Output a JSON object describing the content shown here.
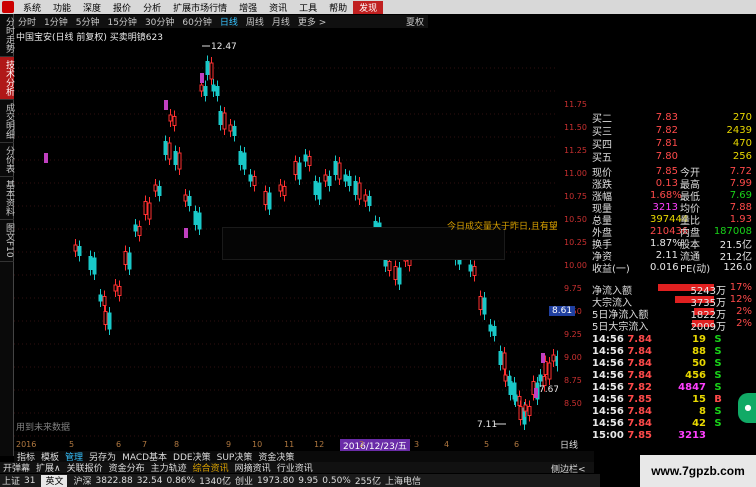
{
  "menubar": {
    "items": [
      "系统",
      "功能",
      "深度",
      "报价",
      "分析",
      "扩展市场行情",
      "增强",
      "资讯",
      "工具",
      "帮助",
      "发现"
    ],
    "active_index": 10
  },
  "periods": {
    "items": [
      "分时",
      "1分钟",
      "5分钟",
      "15分钟",
      "30分钟",
      "60分钟",
      "日线",
      "周线",
      "月线",
      "更多 >"
    ],
    "active_index": 6,
    "right_label": "夏权"
  },
  "side_tabs": {
    "items": [
      "分时走势",
      "技术分析",
      "成交明细",
      "分价表",
      "基本资料",
      "图文F10"
    ],
    "active_index": 1
  },
  "chart": {
    "title": "中国宝安(日线 前复权) 买卖明镜623",
    "high_label": "12.47",
    "low_label": "7.11",
    "marker_right": "7.67",
    "notice": "今日成交量大于昨日,且有望",
    "no_data_text": "用到未来数据"
  },
  "price_axis": {
    "ticks": [
      "11.75",
      "11.50",
      "11.25",
      "11.00",
      "10.75",
      "10.50",
      "10.25",
      "10.00",
      "9.75",
      "9.50",
      "9.25",
      "9.00",
      "8.75",
      "8.50",
      "8.25",
      "8.00",
      "7.75",
      "7.50",
      "7.25"
    ],
    "cursor": "8.61"
  },
  "datebar": {
    "labels": [
      "2016",
      "5",
      "6",
      "7",
      "8",
      "9",
      "10",
      "11",
      "12",
      "2",
      "3",
      "4",
      "5",
      "6"
    ],
    "current_date": "2016/12/23/五",
    "period_label": "日线"
  },
  "indicator_bar": {
    "items": [
      "指标",
      "模板",
      "管理",
      "另存为",
      "MACD基本",
      "DDE决策",
      "SUP决策",
      "资金决策"
    ],
    "active_index": 2
  },
  "bottom_tabs": {
    "items": [
      "开弹幕",
      "扩展∧",
      "关联报价",
      "资金分布",
      "主力轨迹",
      "综合资讯",
      "网摘资讯",
      "行业资讯"
    ],
    "highlight_index": 5,
    "right_label": "侧边栏<"
  },
  "statusbar": {
    "ime_label": "英文",
    "index_name": "上证",
    "index_value": "31",
    "sz_name": "沪深",
    "sz_value": "3822.88",
    "sz_change": "32.54",
    "sz_pct": "0.86%",
    "sz_amount": "1340亿",
    "cy_name": "创业",
    "cy_value": "1973.80",
    "cy_change": "9.95",
    "cy_pct": "0.50%",
    "cy_amount": "255亿",
    "right_text": "上海电信"
  },
  "quote": {
    "asks": [
      {
        "label": "买二",
        "price": "7.83",
        "vol": "270"
      },
      {
        "label": "买三",
        "price": "7.82",
        "vol": "2439"
      },
      {
        "label": "买四",
        "price": "7.81",
        "vol": "470"
      },
      {
        "label": "买五",
        "price": "7.80",
        "vol": "256"
      }
    ],
    "stats": [
      {
        "l1": "现价",
        "v1": "7.85",
        "l2": "今开",
        "v2": "7.72"
      },
      {
        "l1": "涨跌",
        "v1": "0.13",
        "l2": "最高",
        "v2": "7.99"
      },
      {
        "l1": "涨幅",
        "v1": "1.68%",
        "l2": "最低",
        "v2": "7.69"
      },
      {
        "l1": "现量",
        "v1": "3213",
        "l2": "均价",
        "v2": "7.88"
      },
      {
        "l1": "总量",
        "v1": "397444",
        "l2": "量比",
        "v2": "1.93"
      },
      {
        "l1": "外盘",
        "v1": "210436",
        "l2": "内盘",
        "v2": "187008"
      },
      {
        "l1": "换手",
        "v1": "1.87%",
        "l2": "股本",
        "v2": "21.5亿"
      },
      {
        "l1": "净资",
        "v1": "2.11",
        "l2": "流通",
        "v2": "21.2亿"
      },
      {
        "l1": "收益(一)",
        "v1": "0.016",
        "l2": "PE(动)",
        "v2": "126.0"
      }
    ],
    "flows": [
      {
        "label": "净流入额",
        "value": "5243万",
        "pct": "17%",
        "bar": 1.0
      },
      {
        "label": "大宗流入",
        "value": "3735万",
        "pct": "12%",
        "bar": 0.7
      },
      {
        "label": "5日净流入额",
        "value": "1822万",
        "pct": "2%",
        "bar": 0.35
      },
      {
        "label": "5日大宗流入",
        "value": "2009万",
        "pct": "2%",
        "bar": 0.4
      }
    ],
    "ticks": [
      {
        "time": "14:56",
        "price": "7.84",
        "vol": "19",
        "side": "S"
      },
      {
        "time": "14:56",
        "price": "7.84",
        "vol": "88",
        "side": "S"
      },
      {
        "time": "14:56",
        "price": "7.84",
        "vol": "50",
        "side": "S"
      },
      {
        "time": "14:56",
        "price": "7.84",
        "vol": "456",
        "side": "S"
      },
      {
        "time": "14:56",
        "price": "7.82",
        "vol": "4847",
        "side": "S"
      },
      {
        "time": "14:56",
        "price": "7.85",
        "vol": "15",
        "side": "B"
      },
      {
        "time": "14:56",
        "price": "7.84",
        "vol": "8",
        "side": "S"
      },
      {
        "time": "14:56",
        "price": "7.84",
        "vol": "42",
        "side": "S"
      },
      {
        "time": "15:00",
        "price": "7.85",
        "vol": "3213",
        "side": ""
      }
    ]
  },
  "site_text": "www.7gpzb.com",
  "colors": {
    "up": "#ff3030",
    "down": "#19c8c8",
    "buy_marker": "#c040c0"
  }
}
